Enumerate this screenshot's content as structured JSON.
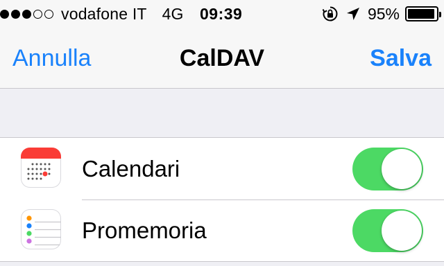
{
  "status_bar": {
    "signal_dots_filled": 3,
    "signal_dots_total": 5,
    "carrier": "vodafone IT",
    "network": "4G",
    "time": "09:39",
    "battery_percent": "95%",
    "battery_level": 0.95,
    "icons": [
      "rotation-lock-icon",
      "location-arrow-icon",
      "battery-icon"
    ]
  },
  "navbar": {
    "cancel_label": "Annulla",
    "title": "CalDAV",
    "save_label": "Salva"
  },
  "settings": {
    "items": [
      {
        "label": "Calendari",
        "icon": "calendar-app-icon",
        "enabled": true
      },
      {
        "label": "Promemoria",
        "icon": "reminders-app-icon",
        "enabled": true
      }
    ]
  },
  "colors": {
    "accent": "#1a82fb",
    "toggle_on": "#4cd964",
    "background": "#efeff4",
    "calendar_red": "#fa3c36"
  }
}
